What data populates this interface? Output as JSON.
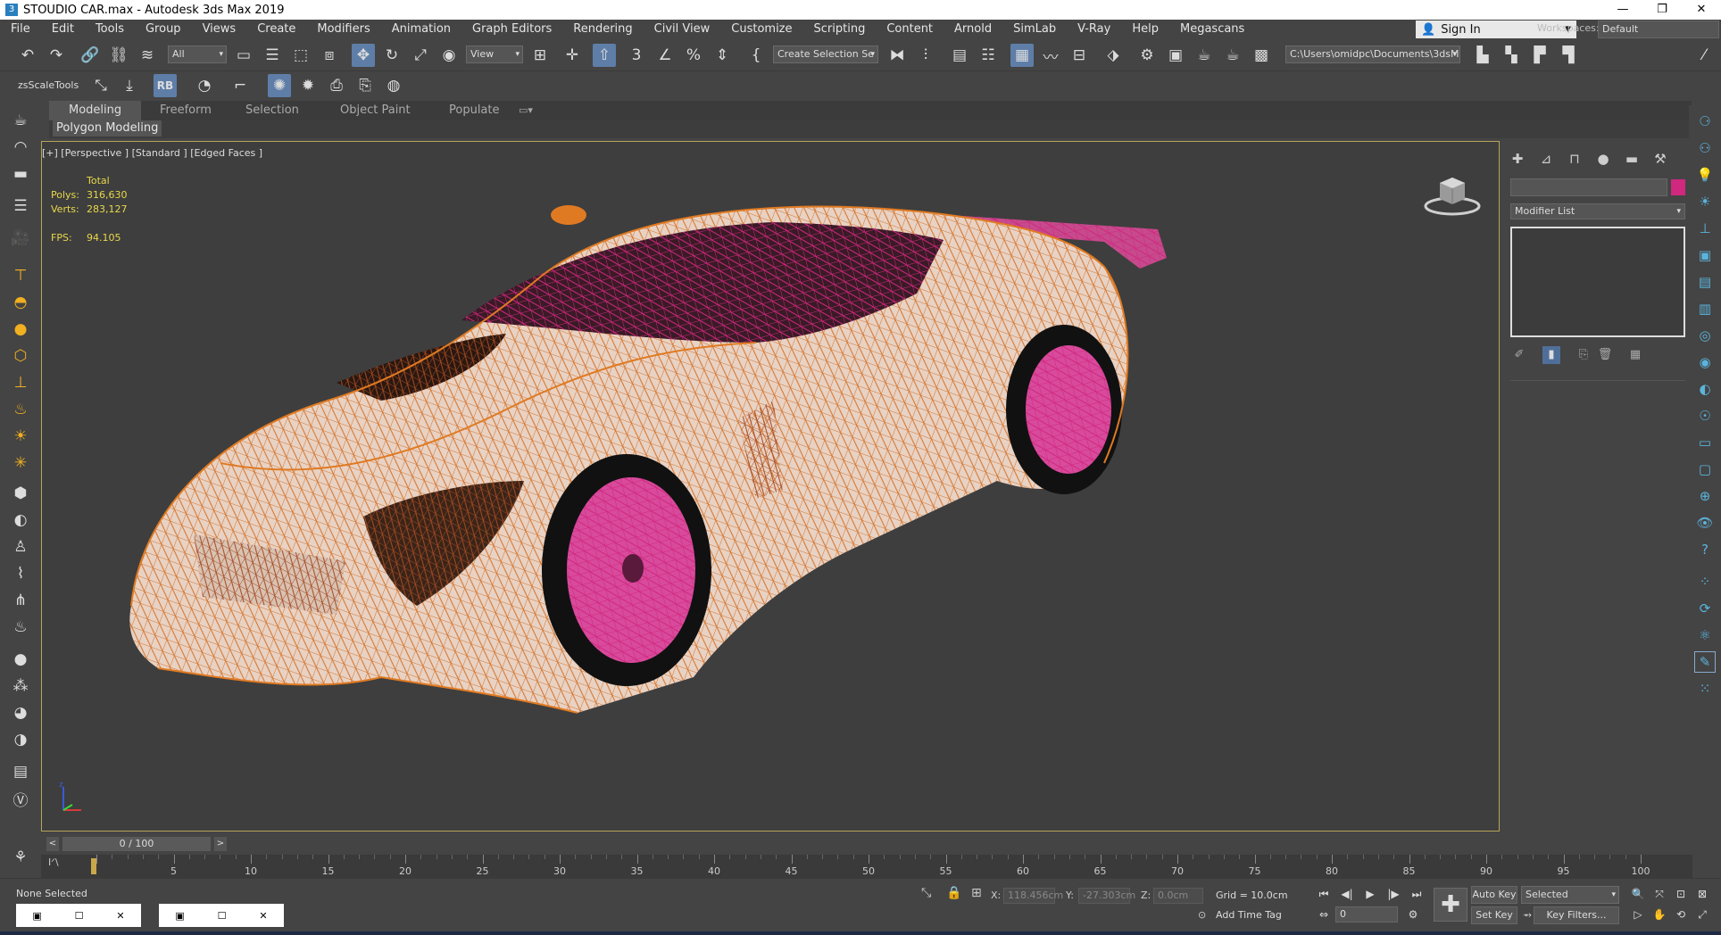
{
  "title": {
    "app_icon": "3",
    "text": "STOUDIO  CAR.max - Autodesk 3ds Max 2019",
    "buttons": [
      "—",
      "❐",
      "✕"
    ]
  },
  "menu": {
    "items": [
      "File",
      "Edit",
      "Tools",
      "Group",
      "Views",
      "Create",
      "Modifiers",
      "Animation",
      "Graph Editors",
      "Rendering",
      "Civil View",
      "Customize",
      "Scripting",
      "Content",
      "Arnold",
      "SimLab",
      "V-Ray",
      "Help",
      "Megascans"
    ],
    "sign_in": "Sign In",
    "workspaces_label": "Workspaces:",
    "workspace_value": "Default"
  },
  "toolbar": {
    "selection_filter": "All",
    "ref_coord": "View",
    "named_selection": "Create Selection Se",
    "project_path": "C:\\Users\\omidpc\\Documents\\3dsMax",
    "zs_label": "zsScaleTools",
    "rb_label": "RB"
  },
  "ribbon": {
    "tabs": [
      "Modeling",
      "Freeform",
      "Selection",
      "Object Paint",
      "Populate"
    ],
    "active_tab": "Modeling",
    "panel_label": "Polygon Modeling"
  },
  "viewport": {
    "label": "[+] [Perspective ] [Standard ] [Edged Faces ]",
    "stats_header": "Total",
    "polys_label": "Polys:",
    "polys_value": "316,630",
    "verts_label": "Verts:",
    "verts_value": "283,127",
    "fps_label": "FPS:",
    "fps_value": "94.105",
    "axis_label": "z"
  },
  "command_panel": {
    "modifier_list": "Modifier List",
    "object_color": "#d0287e"
  },
  "timeline": {
    "frame_display": "0 / 100",
    "prev": "<",
    "next": ">",
    "tick_labels": [
      "5",
      "10",
      "15",
      "20",
      "25",
      "30",
      "35",
      "40",
      "45",
      "50",
      "55",
      "60",
      "65",
      "70",
      "75",
      "80",
      "85",
      "90",
      "95",
      "100"
    ]
  },
  "status": {
    "selection": "None Selected",
    "x_label": "X:",
    "x_value": "118.456cm",
    "y_label": "Y:",
    "y_value": "-27.303cm",
    "z_label": "Z:",
    "z_value": "0.0cm",
    "grid": "Grid = 10.0cm",
    "add_time_tag": "Add Time Tag",
    "auto_key": "Auto Key",
    "set_key": "Set Key",
    "selected": "Selected",
    "key_filters": "Key Filters...",
    "current_frame": "0"
  },
  "colors": {
    "wire_orange": "#e07a22",
    "wire_pink": "#d0287e",
    "car_body": "#e8d2c4",
    "active_tool": "#5e7ea8"
  }
}
